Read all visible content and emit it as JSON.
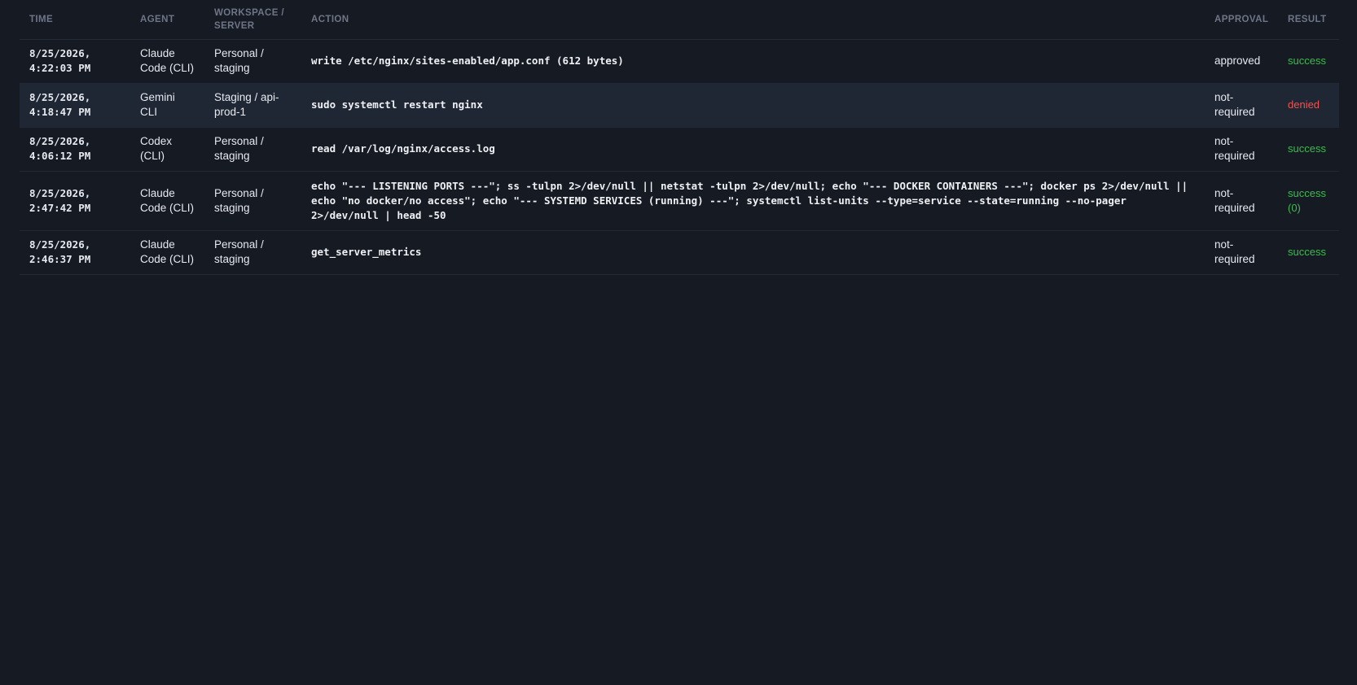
{
  "table": {
    "headers": {
      "time": "TIME",
      "agent": "AGENT",
      "workspace": "WORKSPACE / SERVER",
      "action": "ACTION",
      "approval": "APPROVAL",
      "result": "RESULT"
    },
    "rows": [
      {
        "time": "8/25/2026, 4:22:03 PM",
        "agent": "Claude Code (CLI)",
        "workspace": "Personal / staging",
        "action": "write /etc/nginx/sites-enabled/app.conf (612 bytes)",
        "approval": "approved",
        "result": "success",
        "result_status": "success"
      },
      {
        "time": "8/25/2026, 4:18:47 PM",
        "agent": "Gemini CLI",
        "workspace": "Staging / api-prod-1",
        "action": "sudo systemctl restart nginx",
        "approval": "not-required",
        "result": "denied",
        "result_status": "denied"
      },
      {
        "time": "8/25/2026, 4:06:12 PM",
        "agent": "Codex (CLI)",
        "workspace": "Personal / staging",
        "action": "read /var/log/nginx/access.log",
        "approval": "not-required",
        "result": "success",
        "result_status": "success"
      },
      {
        "time": "8/25/2026, 2:47:42 PM",
        "agent": "Claude Code (CLI)",
        "workspace": "Personal / staging",
        "action": "echo \"--- LISTENING PORTS ---\"; ss -tulpn 2>/dev/null || netstat -tulpn 2>/dev/null; echo \"--- DOCKER CONTAINERS ---\"; docker ps 2>/dev/null || echo \"no docker/no access\"; echo \"--- SYSTEMD SERVICES (running) ---\"; systemctl list-units --type=service --state=running --no-pager 2>/dev/null | head -50",
        "approval": "not-required",
        "result": "success (0)",
        "result_status": "success"
      },
      {
        "time": "8/25/2026, 2:46:37 PM",
        "agent": "Claude Code (CLI)",
        "workspace": "Personal / staging",
        "action": "get_server_metrics",
        "approval": "not-required",
        "result": "success",
        "result_status": "success"
      }
    ]
  },
  "colors": {
    "background": "#161a23",
    "row_highlight": "#1f2634",
    "success": "#3fb950",
    "denied": "#f0544f",
    "header_text": "#6d7587"
  }
}
